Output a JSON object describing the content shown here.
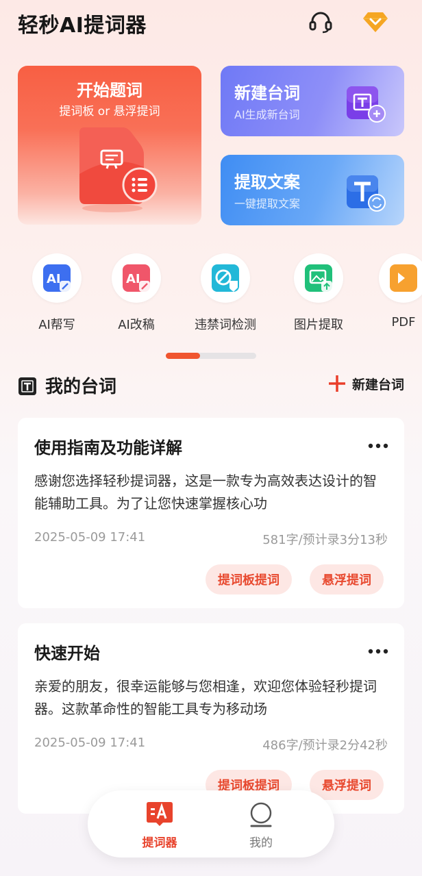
{
  "app": {
    "title": "轻秒AI提词器"
  },
  "header": {
    "support_icon": "headset-icon",
    "vip_icon": "diamond-icon"
  },
  "features": {
    "start": {
      "title": "开始题词",
      "subtitle": "提词板 or 悬浮提词"
    },
    "new_script": {
      "title": "新建台词",
      "subtitle": "AI生成新台词"
    },
    "extract": {
      "title": "提取文案",
      "subtitle": "一键提取文案"
    }
  },
  "tools": [
    {
      "label": "AI帮写",
      "icon": "ai-write-icon",
      "color": "#3d6ff0"
    },
    {
      "label": "AI改稿",
      "icon": "ai-edit-icon",
      "color": "#f0566a"
    },
    {
      "label": "违禁词检测",
      "icon": "forbidden-word-icon",
      "color": "#22b8d8"
    },
    {
      "label": "图片提取",
      "icon": "image-extract-icon",
      "color": "#20c07a"
    },
    {
      "label": "PDF",
      "icon": "pdf-icon",
      "color": "#f7a12f"
    }
  ],
  "section": {
    "title": "我的台词",
    "new_label": "新建台词"
  },
  "scripts": [
    {
      "title": "使用指南及功能详解",
      "desc": "感谢您选择轻秒提词器，这是一款专为高效表达设计的智能辅助工具。为了让您快速掌握核心功",
      "date": "2025-05-09 17:41",
      "stats": "581字/预计录3分13秒",
      "btn_board": "提词板提词",
      "btn_float": "悬浮提词"
    },
    {
      "title": "快速开始",
      "desc": "亲爱的朋友，很幸运能够与您相逢，欢迎您体验轻秒提词器。这款革命性的智能工具专为移动场",
      "date": "2025-05-09 17:41",
      "stats": "486字/预计录2分42秒",
      "btn_board": "提词板提词",
      "btn_float": "悬浮提词"
    }
  ],
  "nav": [
    {
      "label": "提词器",
      "icon": "teleprompter-icon",
      "active": true
    },
    {
      "label": "我的",
      "icon": "profile-icon",
      "active": false
    }
  ],
  "colors": {
    "accent": "#f0552f",
    "active_nav": "#e8432c",
    "inactive_nav": "#777777"
  }
}
